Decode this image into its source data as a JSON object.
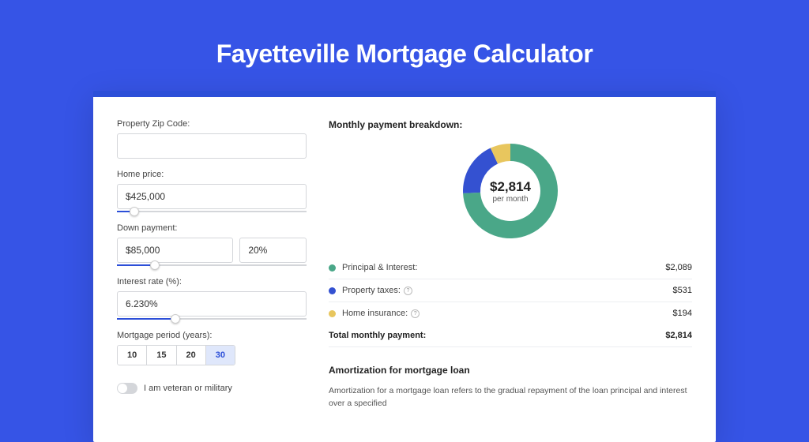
{
  "title": "Fayetteville Mortgage Calculator",
  "form": {
    "zip_label": "Property Zip Code:",
    "zip_value": "",
    "price_label": "Home price:",
    "price_value": "$425,000",
    "price_slider_pct": 9,
    "down_label": "Down payment:",
    "down_value": "$85,000",
    "down_pct_value": "20%",
    "down_slider_pct": 20,
    "rate_label": "Interest rate (%):",
    "rate_value": "6.230%",
    "rate_slider_pct": 31,
    "period_label": "Mortgage period (years):",
    "periods": [
      "10",
      "15",
      "20",
      "30"
    ],
    "period_active": "30",
    "veteran_label": "I am veteran or military"
  },
  "breakdown": {
    "heading": "Monthly payment breakdown:",
    "center_value": "$2,814",
    "center_sub": "per month",
    "items": [
      {
        "color": "green",
        "label": "Principal & Interest:",
        "value": "$2,089",
        "info": false
      },
      {
        "color": "blue",
        "label": "Property taxes:",
        "value": "$531",
        "info": true
      },
      {
        "color": "yellow",
        "label": "Home insurance:",
        "value": "$194",
        "info": true
      }
    ],
    "total_label": "Total monthly payment:",
    "total_value": "$2,814"
  },
  "chart_data": {
    "type": "pie",
    "title": "Monthly payment breakdown",
    "series": [
      {
        "name": "Principal & Interest",
        "value": 2089,
        "color": "#4aa788"
      },
      {
        "name": "Property taxes",
        "value": 531,
        "color": "#3451d1"
      },
      {
        "name": "Home insurance",
        "value": 194,
        "color": "#e8c65e"
      }
    ],
    "total": 2814,
    "center_label": "$2,814 per month"
  },
  "amort": {
    "heading": "Amortization for mortgage loan",
    "body": "Amortization for a mortgage loan refers to the gradual repayment of the loan principal and interest over a specified"
  }
}
